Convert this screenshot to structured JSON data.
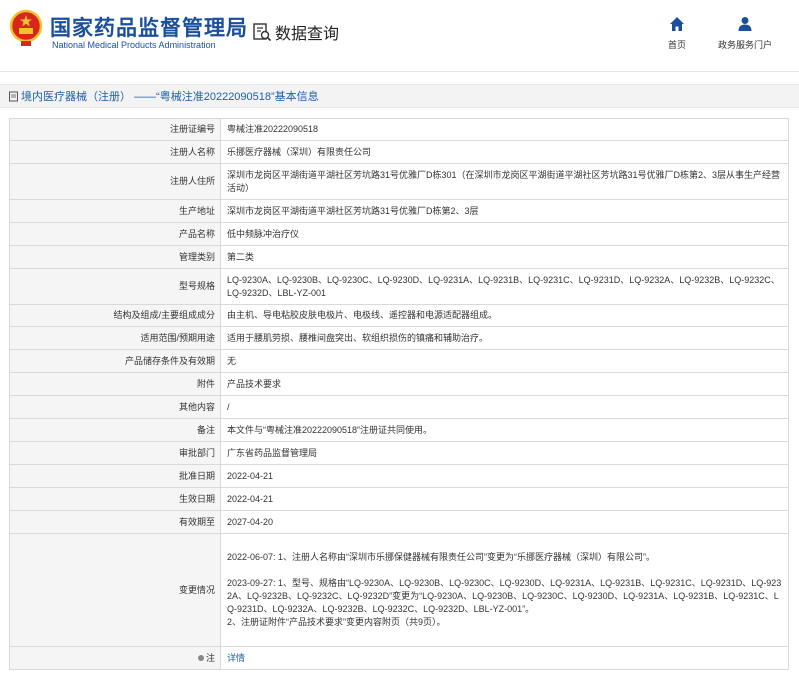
{
  "header": {
    "brand_cn": "国家药品监督管理局",
    "brand_en": "National Medical Products Administration",
    "search_title": "数据查询",
    "nav_home": "首页",
    "nav_gov": "政务服务门户"
  },
  "title_bar": {
    "text": "境内医疗器械（注册） ——“粤械注准20222090518”基本信息"
  },
  "rows": [
    {
      "label": "注册证编号",
      "value": "粤械注准20222090518"
    },
    {
      "label": "注册人名称",
      "value": "乐挪医疗器械（深圳）有限责任公司"
    },
    {
      "label": "注册人住所",
      "value": "深圳市龙岗区平湖街道平湖社区芳坑路31号优雅厂D栋301（在深圳市龙岗区平湖街道平湖社区芳坑路31号优雅厂D栋第2、3层从事生产经营活动）"
    },
    {
      "label": "生产地址",
      "value": "深圳市龙岗区平湖街道平湖社区芳坑路31号优雅厂D栋第2、3层"
    },
    {
      "label": "产品名称",
      "value": "低中频脉冲治疗仪"
    },
    {
      "label": "管理类别",
      "value": "第二类"
    },
    {
      "label": "型号规格",
      "value": "LQ-9230A、LQ-9230B、LQ-9230C、LQ-9230D、LQ-9231A、LQ-9231B、LQ-9231C、LQ-9231D、LQ-9232A、LQ-9232B、LQ-9232C、LQ-9232D、LBL-YZ-001"
    },
    {
      "label": "结构及组成/主要组成成分",
      "value": "由主机、导电粘胶皮肤电极片、电极线、遥控器和电源适配器组成。"
    },
    {
      "label": "适用范围/预期用途",
      "value": "适用于腰肌劳损、腰椎间盘突出、软组织损伤的镇痛和辅助治疗。"
    },
    {
      "label": "产品储存条件及有效期",
      "value": "无"
    },
    {
      "label": "附件",
      "value": "产品技术要求"
    },
    {
      "label": "其他内容",
      "value": "/"
    },
    {
      "label": "备注",
      "value": "本文件与“粤械注准20222090518”注册证共同使用。"
    },
    {
      "label": "审批部门",
      "value": "广东省药品监督管理局"
    },
    {
      "label": "批准日期",
      "value": "2022-04-21"
    },
    {
      "label": "生效日期",
      "value": "2022-04-21"
    },
    {
      "label": "有效期至",
      "value": "2027-04-20"
    },
    {
      "label": "变更情况",
      "value": "2022-06-07: 1、注册人名称由“深圳市乐挪保健器械有限责任公司”变更为“乐挪医疗器械（深圳）有限公司”。\n\n2023-09-27: 1、型号、规格由“LQ-9230A、LQ-9230B、LQ-9230C、LQ-9230D、LQ-9231A、LQ-9231B、LQ-9231C、LQ-9231D、LQ-9232A、LQ-9232B、LQ-9232C、LQ-9232D”变更为“LQ-9230A、LQ-9230B、LQ-9230C、LQ-9230D、LQ-9231A、LQ-9231B、LQ-9231C、LQ-9231D、LQ-9232A、LQ-9232B、LQ-9232C、LQ-9232D、LBL-YZ-001”。\n2、注册证附件“产品技术要求”变更内容附页（共9页）。"
    },
    {
      "label": "注",
      "value": "详情"
    }
  ],
  "colors": {
    "brand": "#1a4f9c",
    "link": "#1e5fa8",
    "emblem_red": "#d7261e",
    "emblem_gold": "#f2c12e"
  },
  "icons": {
    "emblem": "national-emblem-icon",
    "search": "search-doc-icon",
    "home": "home-icon",
    "user": "user-icon",
    "doc": "document-icon",
    "note": "note-icon"
  }
}
